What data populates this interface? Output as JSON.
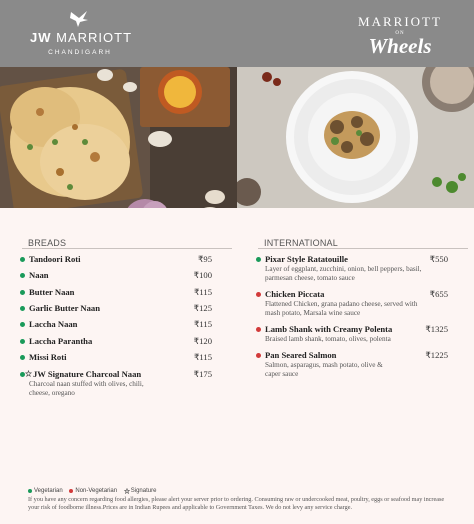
{
  "header": {
    "left_brand_prefix": "JW",
    "left_brand_name": "MARRIOTT",
    "left_city": "CHANDIGARH",
    "right_brand": "MARRIOTT",
    "right_on": "ON",
    "right_script": "Wheels"
  },
  "breads": {
    "title": "BREADS",
    "items": [
      {
        "name": "Tandoori Roti",
        "price": "₹95",
        "type": "veg"
      },
      {
        "name": "Naan",
        "price": "₹100",
        "type": "veg"
      },
      {
        "name": "Butter Naan",
        "price": "₹115",
        "type": "veg"
      },
      {
        "name": "Garlic Butter Naan",
        "price": "₹125",
        "type": "veg"
      },
      {
        "name": "Laccha Naan",
        "price": "₹115",
        "type": "veg"
      },
      {
        "name": "Laccha Parantha",
        "price": "₹120",
        "type": "veg"
      },
      {
        "name": "Missi Roti",
        "price": "₹115",
        "type": "veg"
      },
      {
        "name": "JW Signature Charcoal Naan",
        "price": "₹175",
        "type": "veg-signature",
        "desc": "Charcoal naan stuffed with olives, chili, cheese, oregano"
      }
    ]
  },
  "international": {
    "title": "INTERNATIONAL",
    "items": [
      {
        "name": "Pixar Style Ratatouille",
        "price": "₹550",
        "type": "veg",
        "desc": "Layer of eggplant, zucchini, onion, bell peppers, basil, parmesan cheese, tomato sauce"
      },
      {
        "name": "Chicken Piccata",
        "price": "₹655",
        "type": "nonveg",
        "desc": "Flattened Chicken, grana padano cheese, served with mash potato, Marsala wine sauce"
      },
      {
        "name": "Lamb Shank with Creamy Polenta",
        "price": "₹1325",
        "type": "nonveg",
        "desc": "Braised lamb shank, tomato, olives, polenta"
      },
      {
        "name": "Pan Seared Salmon",
        "price": "₹1225",
        "type": "nonveg",
        "desc": "Salmon, asparagus, mash potato, olive & caper sauce"
      }
    ]
  },
  "legend": {
    "veg": "Vegetarian",
    "nonveg": "Non-Vegetarian",
    "signature": "Signature"
  },
  "disclaimer": "If you have any concern regarding food allergies, please alert your server prior to ordering. Consuming raw or undercooked meat, poultry, eggs or seafood may increase your risk of foodborne illness.Prices are in Indian Rupees and applicable to Government Taxes. We do not levy any service charge.",
  "colors": {
    "veg": "#1a9a5a",
    "nonveg": "#d23a3a",
    "header": "#8a8a8a",
    "background": "#fdf5f3"
  }
}
